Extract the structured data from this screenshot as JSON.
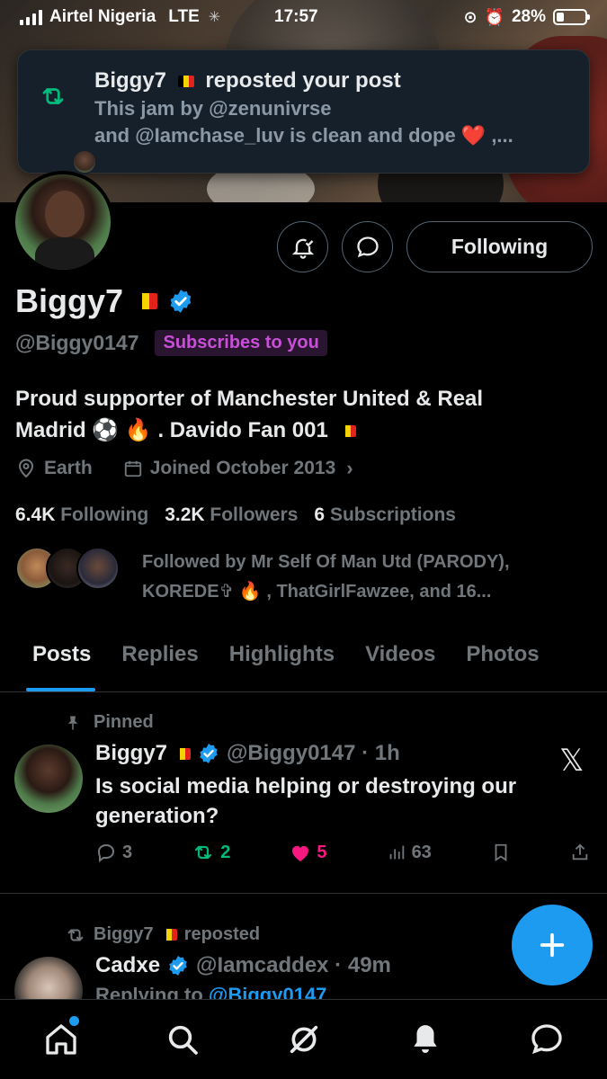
{
  "status_bar": {
    "carrier": "Airtel Nigeria",
    "network": "LTE",
    "time": "17:57",
    "battery": "28%",
    "battery_level": 0.28
  },
  "notification": {
    "title_name": "Biggy7",
    "title_action": "reposted your post",
    "line1": "This jam by @zenunivrse",
    "line2": "and @Iamchase_luv is clean and dope ❤️ ,..."
  },
  "profile": {
    "display_name": "Biggy7",
    "handle": "@Biggy0147",
    "subscribes_badge": "Subscribes to you",
    "bio_line1": "Proud supporter of Manchester United & Real",
    "bio_line2": "Madrid ⚽ 🔥 . Davido Fan 001",
    "location": "Earth",
    "joined": "Joined October 2013",
    "following_count": "6.4K",
    "following_label": "Following",
    "followers_count": "3.2K",
    "followers_label": "Followers",
    "subscriptions_count": "6",
    "subscriptions_label": "Subscriptions",
    "followed_by_line1": "Followed by Mr Self Of Man Utd (PARODY),",
    "followed_by_line2": "KOREDE✞ 🔥 , ThatGirlFawzee, and 16...",
    "follow_button": "Following"
  },
  "tabs": [
    "Posts",
    "Replies",
    "Highlights",
    "Videos",
    "Photos"
  ],
  "active_tab": "Posts",
  "posts": [
    {
      "pinned_label": "Pinned",
      "name": "Biggy7",
      "handle_time": "@Biggy0147 · 1h",
      "text_line1": "Is social media helping or destroying our",
      "text_line2": "generation?",
      "replies": "3",
      "reposts": "2",
      "likes": "5",
      "views": "63"
    },
    {
      "repost_label": "Biggy7",
      "repost_suffix": "reposted",
      "name": "Cadxe",
      "handle_time": "@Iamcaddex · 49m",
      "replying_prefix": "Replying to",
      "replying_to": "@Biggy0147"
    }
  ],
  "colors": {
    "accent": "#1d9bf0",
    "repost": "#00ba7c",
    "like": "#f91880",
    "badge": "#c94fd8",
    "flag": [
      "#000000",
      "#f4d400",
      "#e2231a"
    ]
  }
}
